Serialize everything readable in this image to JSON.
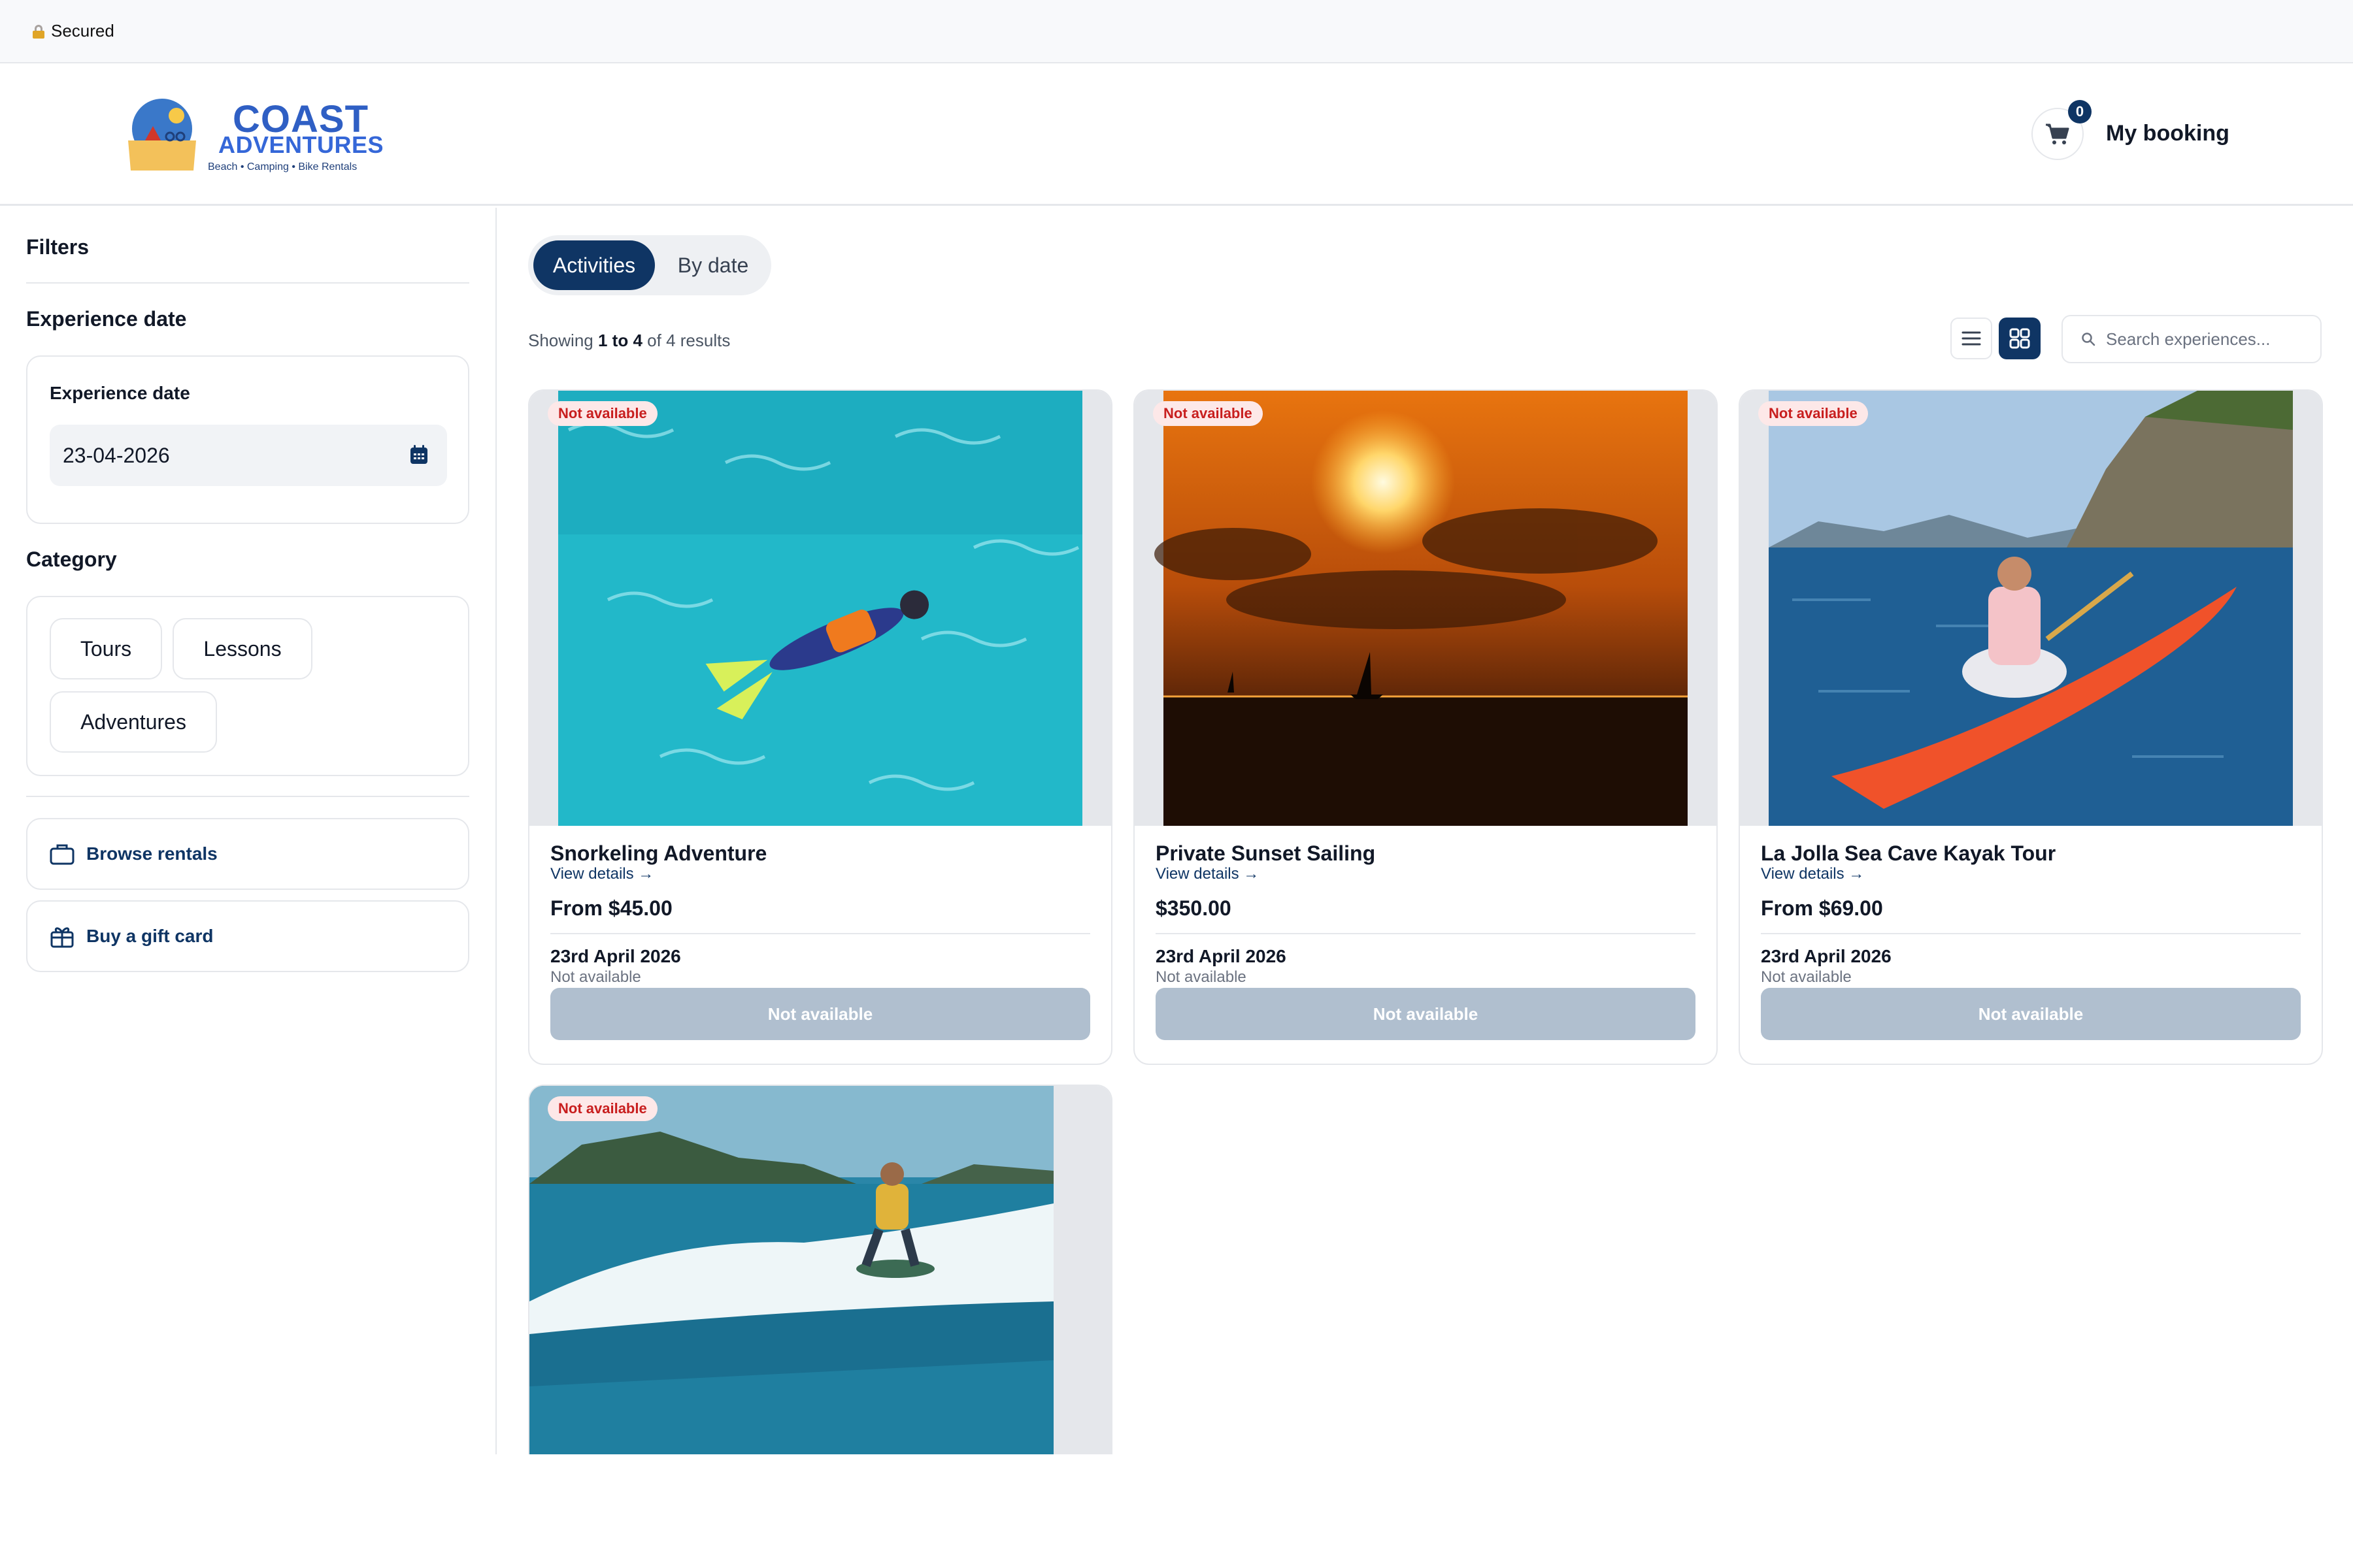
{
  "browser": {
    "security_label": "Secured"
  },
  "header": {
    "logo": {
      "line1": "COAST",
      "line2": "ADVENTURES",
      "tagline": "Beach • Camping • Bike Rentals"
    },
    "cart_count": "0",
    "my_booking_label": "My booking"
  },
  "sidebar": {
    "filters_heading": "Filters",
    "experience_date_heading": "Experience date",
    "date_panel_label": "Experience date",
    "date_value": "23-04-2026",
    "category_heading": "Category",
    "categories": [
      "Tours",
      "Lessons",
      "Adventures"
    ],
    "links": [
      {
        "label": "Browse rentals",
        "icon": "briefcase-icon"
      },
      {
        "label": "Buy a gift card",
        "icon": "gift-icon"
      }
    ]
  },
  "main": {
    "tabs": [
      {
        "label": "Activities",
        "active": true
      },
      {
        "label": "By date",
        "active": false
      }
    ],
    "results": {
      "prefix": "Showing",
      "from": "1",
      "to_word": "to",
      "to": "4",
      "suffix": "of 4 results"
    },
    "search_placeholder": "Search experiences...",
    "cards": [
      {
        "badge": "Not available",
        "title": "Snorkeling Adventure",
        "view_details": "View details →",
        "price": "From $45.00",
        "date": "23rd April 2026",
        "status": "Not available",
        "button": "Not available"
      },
      {
        "badge": "Not available",
        "title": "Private Sunset Sailing",
        "view_details": "View details →",
        "price": "$350.00",
        "date": "23rd April 2026",
        "status": "Not available",
        "button": "Not available"
      },
      {
        "badge": "Not available",
        "title": "La Jolla Sea Cave Kayak Tour",
        "view_details": "View details →",
        "price": "From $69.00",
        "date": "23rd April 2026",
        "status": "Not available",
        "button": "Not available"
      },
      {
        "badge": "Not available"
      }
    ]
  },
  "colors": {
    "primary": "#0f3564",
    "badge_bg": "#fde8e8",
    "badge_text": "#c81e1e",
    "disabled_button": "#b0bfcf"
  }
}
